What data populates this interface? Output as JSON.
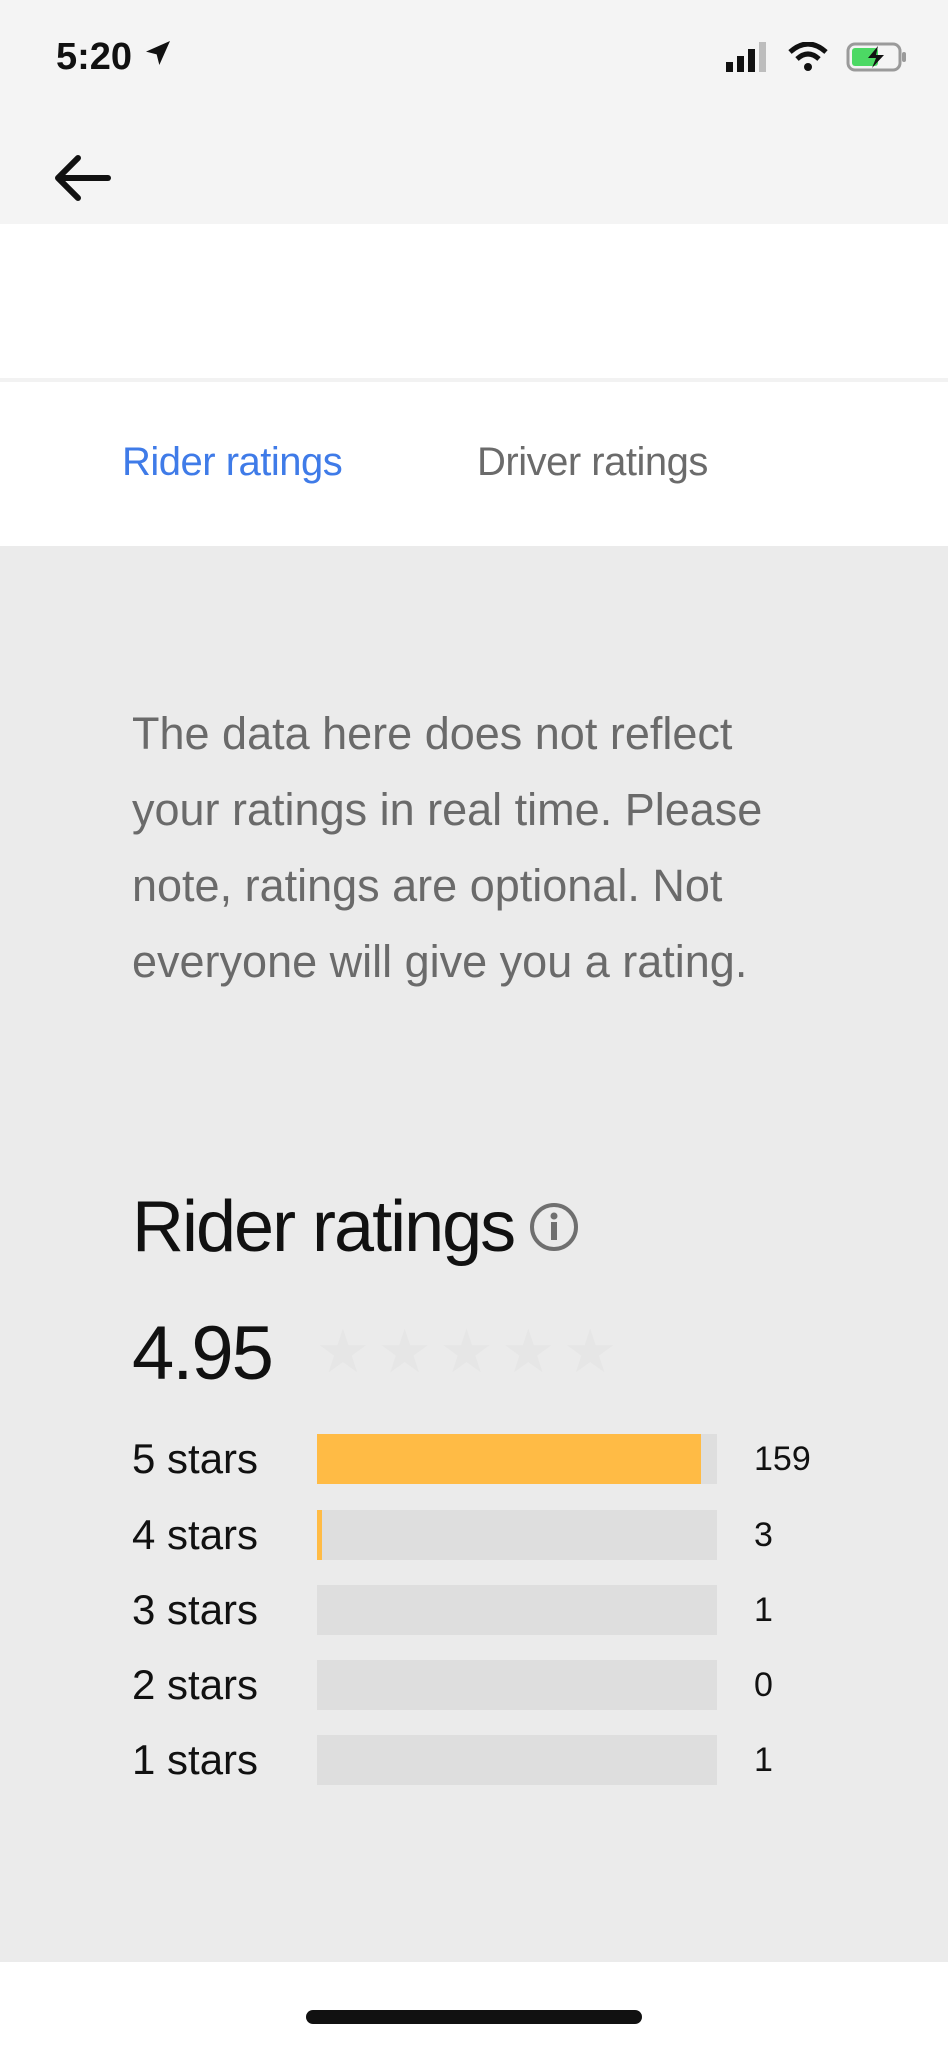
{
  "status_bar": {
    "time": "5:20",
    "icons": [
      "location-arrow-icon",
      "cellular-signal-icon",
      "wifi-icon",
      "battery-charging-icon"
    ],
    "battery_color": "#4cd964"
  },
  "nav": {
    "back_icon": "arrow-left-icon"
  },
  "tabs": {
    "rider": "Rider ratings",
    "driver": "Driver ratings",
    "active_color": "#3f7be8"
  },
  "disclaimer": "The data here does not reflect your ratings in real time. Please note, ratings are optional. Not everyone will give you a rating.",
  "ratings": {
    "title": "Rider ratings",
    "info_icon": "info-circle-icon",
    "average": "4.95",
    "stars_total": 5,
    "bar_color": "#ffbb45",
    "distribution": [
      {
        "label": "5 stars",
        "count": "159",
        "fraction": 0.96
      },
      {
        "label": "4 stars",
        "count": "3",
        "fraction": 0.012
      },
      {
        "label": "3 stars",
        "count": "1",
        "fraction": 0
      },
      {
        "label": "2 stars",
        "count": "0",
        "fraction": 0
      },
      {
        "label": "1 stars",
        "count": "1",
        "fraction": 0
      }
    ]
  }
}
